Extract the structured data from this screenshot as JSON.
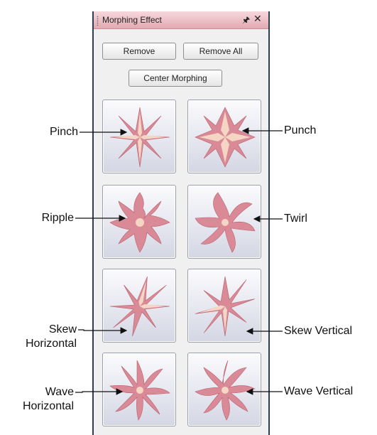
{
  "panel": {
    "title": "Morphing Effect",
    "pin_icon": "pin-icon",
    "close_icon": "close-icon",
    "buttons": {
      "remove": "Remove",
      "remove_all": "Remove All",
      "center_morphing": "Center Morphing"
    }
  },
  "effects": [
    {
      "name": "pinch",
      "icon": "pinch-star-icon"
    },
    {
      "name": "punch",
      "icon": "punch-star-icon"
    },
    {
      "name": "ripple",
      "icon": "ripple-star-icon"
    },
    {
      "name": "twirl",
      "icon": "twirl-star-icon"
    },
    {
      "name": "skew-horizontal",
      "icon": "skew-horizontal-star-icon"
    },
    {
      "name": "skew-vertical",
      "icon": "skew-vertical-star-icon"
    },
    {
      "name": "wave-horizontal",
      "icon": "wave-horizontal-star-icon"
    },
    {
      "name": "wave-vertical",
      "icon": "wave-vertical-star-icon"
    }
  ],
  "callouts": {
    "pinch": "Pinch",
    "punch": "Punch",
    "ripple": "Ripple",
    "twirl": "Twirl",
    "skew_horizontal_line1": "Skew",
    "skew_horizontal_line2": "Horizontal",
    "skew_vertical": "Skew Vertical",
    "wave_horizontal_line1": "Wave",
    "wave_horizontal_line2": "Horizontal",
    "wave_vertical": "Wave Vertical"
  },
  "colors": {
    "title_bar": "#e8b4bb",
    "star_fill": "#d98a96",
    "star_highlight": "#f5d6c4",
    "panel_border": "#2d3e55"
  }
}
